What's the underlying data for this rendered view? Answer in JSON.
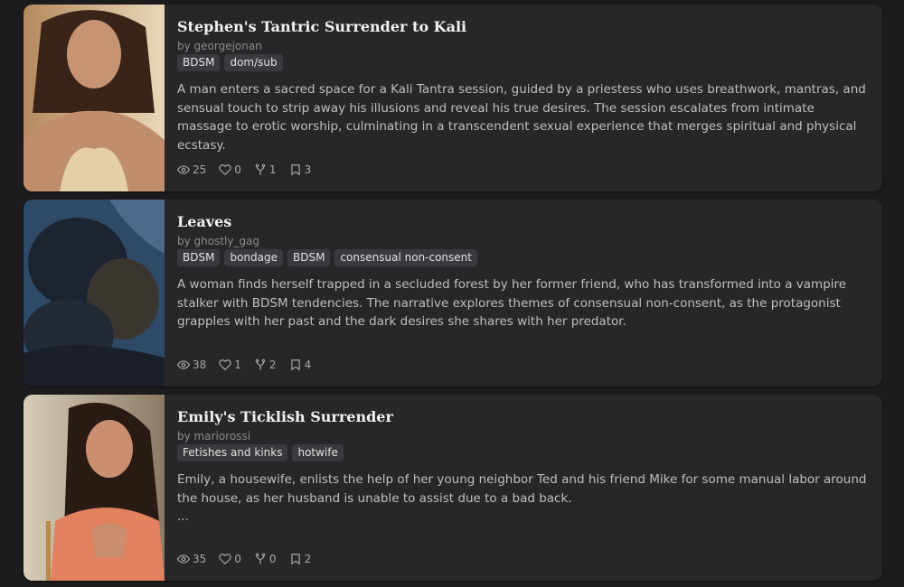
{
  "stories": [
    {
      "title": "Stephen's Tantric Surrender to Kali",
      "author": "by georgejonan",
      "tags": [
        "BDSM",
        "dom/sub"
      ],
      "description": "A man enters a sacred space for a Kali Tantra session, guided by a priestess who uses breathwork, mantras, and sensual touch to strip away his illusions and reveal his true desires. The session escalates from intimate massage to erotic worship, culminating in a transcendent sexual experience that merges spiritual and physical ecstasy.",
      "stats": {
        "views": "25",
        "likes": "0",
        "forks": "1",
        "bookmarks": "3"
      }
    },
    {
      "title": "Leaves",
      "author": "by ghostly_gag",
      "tags": [
        "BDSM",
        "bondage",
        "BDSM",
        "consensual non-consent"
      ],
      "description": "A woman finds herself trapped in a secluded forest by her former friend, who has transformed into a vampire stalker with BDSM tendencies. The narrative explores themes of consensual non-consent, as the protagonist grapples with her past and the dark desires she shares with her predator.",
      "stats": {
        "views": "38",
        "likes": "1",
        "forks": "2",
        "bookmarks": "4"
      }
    },
    {
      "title": "Emily's Ticklish Surrender",
      "author": "by mariorossi",
      "tags": [
        "Fetishes and kinks",
        "hotwife"
      ],
      "description": "Emily, a housewife, enlists the help of her young neighbor Ted and his friend Mike for some manual labor around the house, as her husband is unable to assist due to a bad back.",
      "description_extra": "...",
      "stats": {
        "views": "35",
        "likes": "0",
        "forks": "0",
        "bookmarks": "2"
      }
    }
  ],
  "icons": {
    "views": "eye-icon",
    "likes": "heart-icon",
    "forks": "fork-icon",
    "bookmarks": "bookmark-icon"
  }
}
